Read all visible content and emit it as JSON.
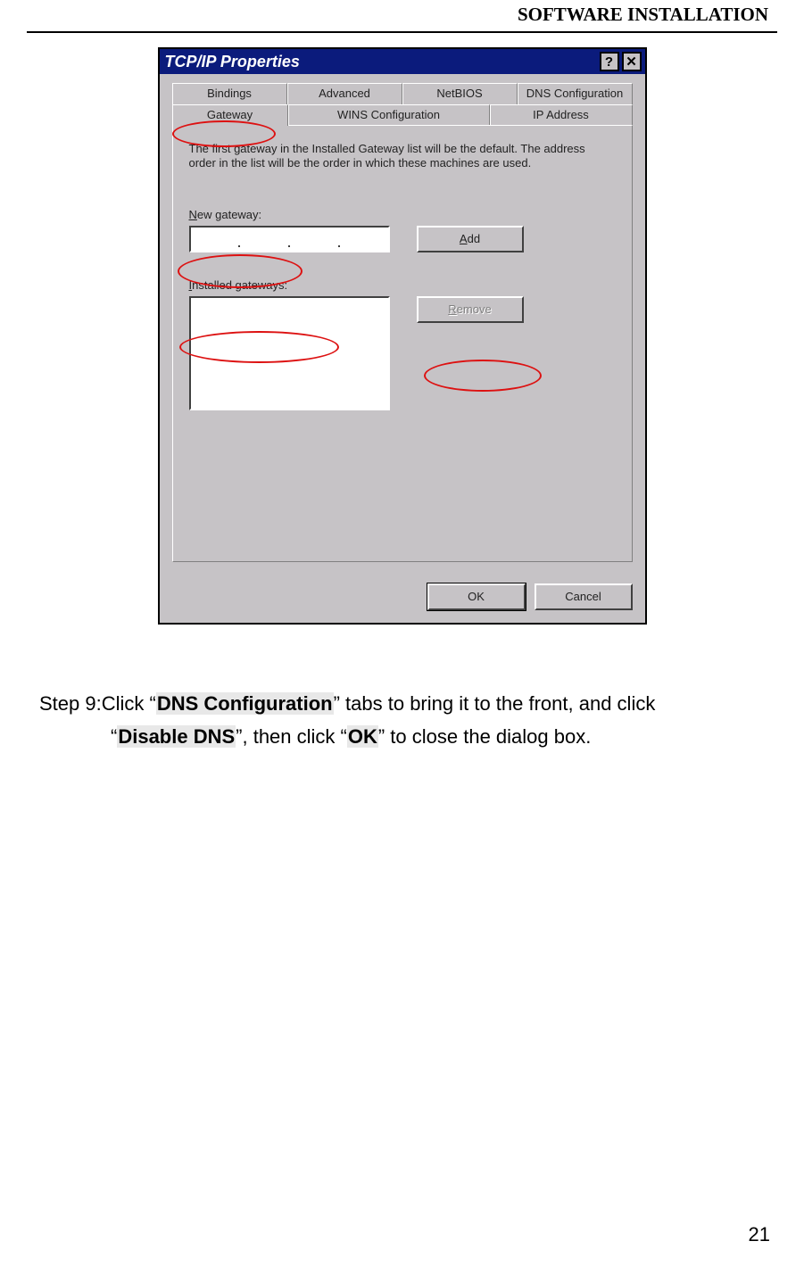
{
  "header": "SOFTWARE INSTALLATION",
  "dialog": {
    "title": "TCP/IP Properties",
    "help_btn": "?",
    "close_btn": "✕",
    "tabs_row1": [
      "Bindings",
      "Advanced",
      "NetBIOS",
      "DNS Configuration"
    ],
    "tabs_row2": [
      "Gateway",
      "WINS Configuration",
      "IP Address"
    ],
    "help_text": "The first gateway in the Installed Gateway list will be the default. The address order in the list will be the order in which these machines are used.",
    "new_gateway_label": "New gateway:",
    "add_label": "Add",
    "installed_label": "Installed gateways:",
    "remove_label": "Remove",
    "ok_label": "OK",
    "cancel_label": "Cancel"
  },
  "step": {
    "prefix": "Step 9:Click “",
    "dns_conf": "DNS Configuration",
    "mid1": "” tabs to bring it to the front, and click",
    "line2_open": "“",
    "disable_dns": "Disable DNS",
    "mid2": "”, then click “",
    "ok": "OK",
    "suffix": "” to close the dialog box."
  },
  "page_number": "21"
}
